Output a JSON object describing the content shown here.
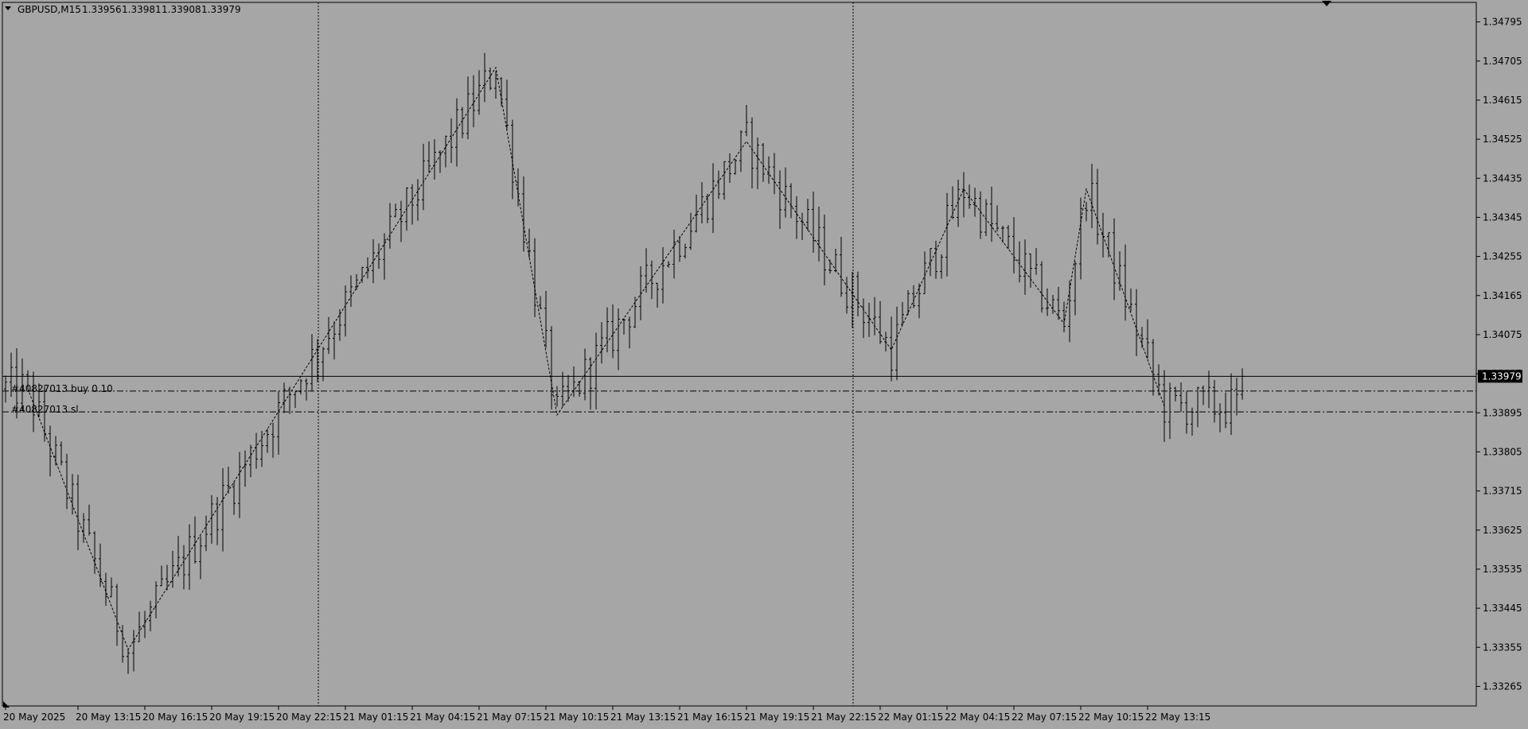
{
  "header": {
    "symbol": "GBPUSD,M15",
    "open": "1.33956",
    "high": "1.33981",
    "low": "1.33908",
    "close": "1.33979"
  },
  "current_price_label": "1.33979",
  "order_labels": {
    "buy": "#40827013 buy 0.10",
    "sl": "#40827013 sl"
  },
  "colors": {
    "background": "#a6a6a6",
    "bars": "#000000",
    "price_tag_bg": "#000000",
    "price_tag_text": "#ffffff"
  },
  "chart_data": {
    "type": "ohlc",
    "symbol": "GBPUSD",
    "timeframe": "M15",
    "ylim": [
      1.3322,
      1.3484
    ],
    "y_ticks": [
      "1.34795",
      "1.34705",
      "1.34615",
      "1.34525",
      "1.34435",
      "1.34345",
      "1.34255",
      "1.34165",
      "1.34075",
      "1.33985",
      "1.33895",
      "1.33805",
      "1.33715",
      "1.33625",
      "1.33535",
      "1.33445",
      "1.33355",
      "1.33265"
    ],
    "x_ticks": [
      "20 May 2025",
      "20 May 13:15",
      "20 May 16:15",
      "20 May 19:15",
      "20 May 22:15",
      "21 May 01:15",
      "21 May 04:15",
      "21 May 07:15",
      "21 May 10:15",
      "21 May 13:15",
      "21 May 16:15",
      "21 May 19:15",
      "21 May 22:15",
      "22 May 01:15",
      "22 May 04:15",
      "22 May 07:15",
      "22 May 10:15",
      "22 May 13:15"
    ],
    "bar_period_minutes": 15,
    "bars_count": 223,
    "current_price": 1.33979,
    "buy_order_price": 1.33945,
    "stop_loss_price": 1.33897,
    "day_separators": [
      "21 May 00:00",
      "22 May 00:00"
    ],
    "zigzag": [
      {
        "time": "20 May 11:00",
        "price": 1.3395
      },
      {
        "time": "20 May 15:30",
        "price": 1.3335
      },
      {
        "time": "21 May 08:00",
        "price": 1.3469
      },
      {
        "time": "21 May 10:45",
        "price": 1.3389
      },
      {
        "time": "21 May 19:15",
        "price": 1.3452
      },
      {
        "time": "22 May 01:45",
        "price": 1.3404
      },
      {
        "time": "22 May 05:00",
        "price": 1.3441
      },
      {
        "time": "22 May 09:30",
        "price": 1.341
      },
      {
        "time": "22 May 10:30",
        "price": 1.3441
      },
      {
        "time": "22 May 14:00",
        "price": 1.3391
      }
    ],
    "grid": false
  }
}
